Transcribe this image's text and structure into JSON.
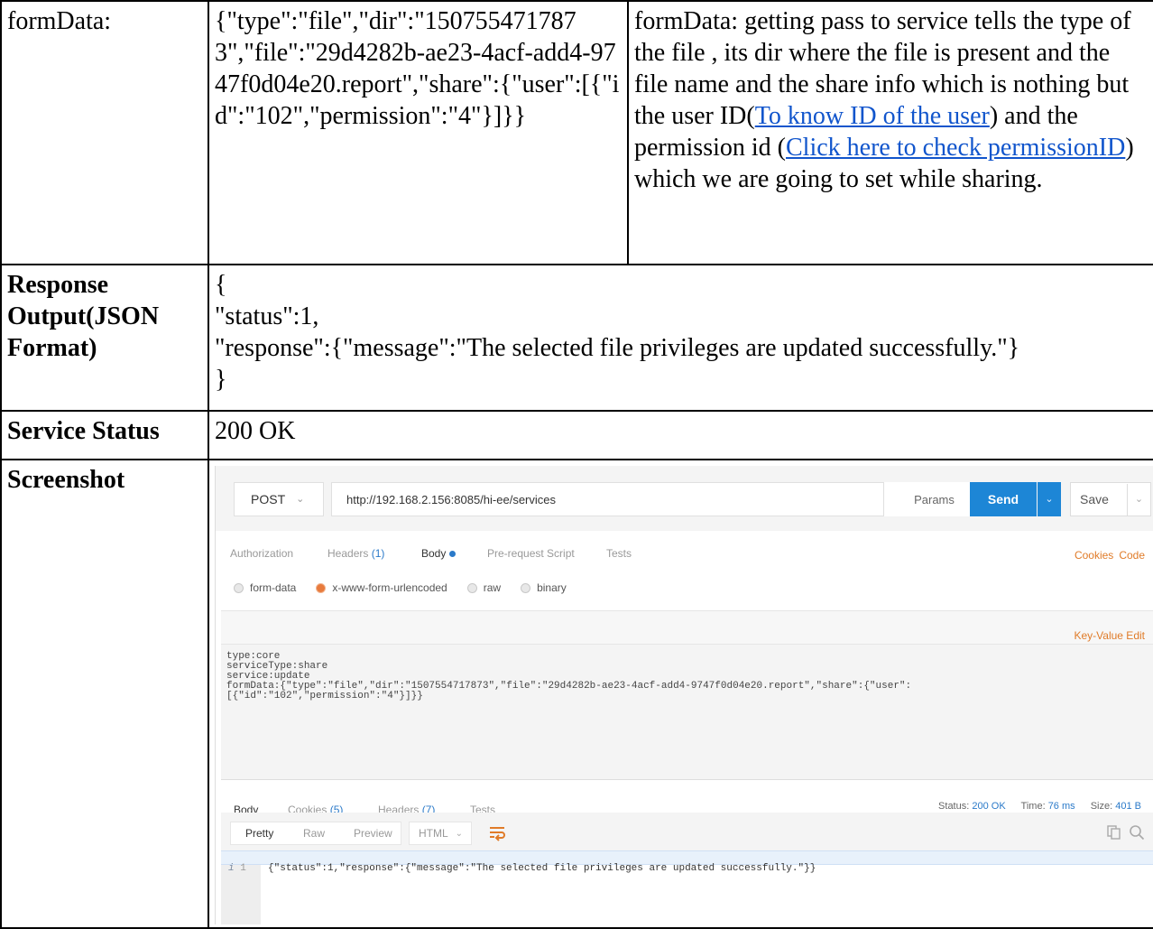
{
  "rows": {
    "formdata": {
      "label": "formData:",
      "value": "{\"type\":\"file\",\"dir\":\"1507554717873\",\"file\":\"29d4282b-ae23-4acf-add4-9747f0d04e20.report\",\"share\":{\"user\":[{\"id\":\"102\",\"permission\":\"4\"}]}}",
      "desc_before": "formData: getting pass to service tells the type of the file , its dir where the file is present and the file name and the share info which is nothing but the user ID(",
      "link1": "To know ID of the user",
      "desc_mid": ") and the permission id (",
      "link2": "Click here to check permissionID",
      "desc_after": ") which we are going to set while sharing."
    },
    "response": {
      "label": "Response Output(JSON Format)",
      "line1": "{",
      "line2": "\"status\":1,",
      "line3": "\"response\":{\"message\":\"The selected file privileges are updated successfully.\"}",
      "line4": "}"
    },
    "status": {
      "label": "Service Status",
      "value": "200 OK"
    },
    "screenshot": {
      "label": "Screenshot"
    }
  },
  "postman": {
    "method": "POST",
    "url": "http://192.168.2.156:8085/hi-ee/services",
    "params": "Params",
    "send": "Send",
    "save": "Save",
    "tabs": {
      "authorization": "Authorization",
      "headers": "Headers",
      "headers_count": "(1)",
      "body": "Body",
      "prerequest": "Pre-request Script",
      "tests": "Tests"
    },
    "cookies": "Cookies",
    "code": "Code",
    "body_types": {
      "form_data": "form-data",
      "urlencoded": "x-www-form-urlencoded",
      "raw": "raw",
      "binary": "binary"
    },
    "key_value_edit": "Key-Value Edit",
    "editor_lines": [
      "type:core",
      "serviceType:share",
      "service:update",
      "formData:{\"type\":\"file\",\"dir\":\"1507554717873\",\"file\":\"29d4282b-ae23-4acf-add4-9747f0d04e20.report\",\"share\":{\"user\":",
      "[{\"id\":\"102\",\"permission\":\"4\"}]}}"
    ],
    "response_tabs": {
      "body": "Body",
      "cookies": "Cookies",
      "cookies_count": "(5)",
      "headers": "Headers",
      "headers_count": "(7)",
      "tests": "Tests"
    },
    "status_label": "Status:",
    "status_value": "200 OK",
    "time_label": "Time:",
    "time_value": "76 ms",
    "size_label": "Size:",
    "size_value": "401 B",
    "view": {
      "pretty": "Pretty",
      "raw": "Raw",
      "preview": "Preview",
      "format": "HTML"
    },
    "output_line_no": "1",
    "output_code": "{\"status\":1,\"response\":{\"message\":\"The selected file privileges are updated successfully.\"}}",
    "icons": [
      "chevron-down-icon",
      "wrap-icon",
      "copy-icon",
      "search-icon"
    ]
  }
}
